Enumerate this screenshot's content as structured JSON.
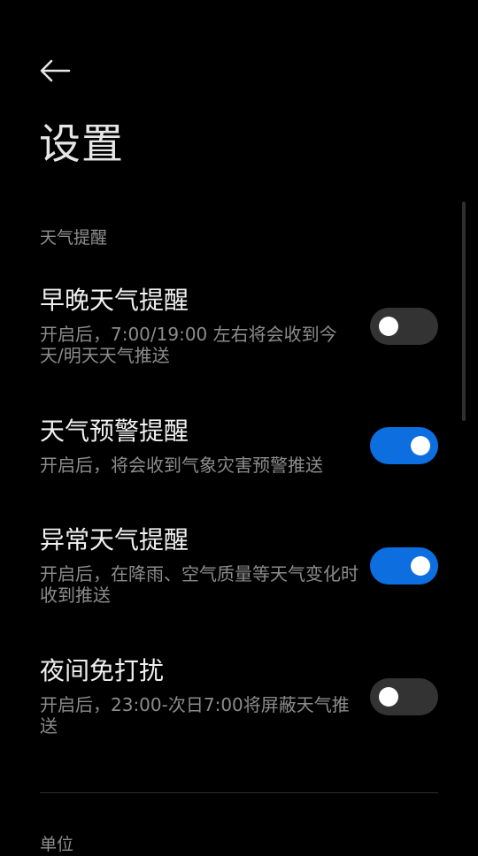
{
  "header": {
    "back_icon": "arrow-left-icon",
    "title": "设置"
  },
  "weather_section": {
    "header": "天气提醒",
    "items": [
      {
        "title": "早晚天气提醒",
        "description": "开启后，7:00/19:00 左右将会收到今天/明天天气推送",
        "enabled": false
      },
      {
        "title": "天气预警提醒",
        "description": "开启后，将会收到气象灾害预警推送",
        "enabled": true
      },
      {
        "title": "异常天气提醒",
        "description": "开启后，在降雨、空气质量等天气变化时收到推送",
        "enabled": true
      },
      {
        "title": "夜间免打扰",
        "description": "开启后，23:00-次日7:00将屏蔽天气推送",
        "enabled": false
      }
    ]
  },
  "units_section": {
    "header": "单位"
  },
  "colors": {
    "background": "#000000",
    "accent": "#0d6ee0",
    "toggle_off": "#333333",
    "title_text": "#f0f0f0",
    "secondary_text": "#8c8c8c"
  }
}
